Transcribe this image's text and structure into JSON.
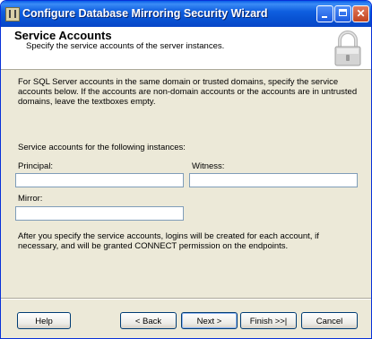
{
  "window": {
    "title": "Configure Database Mirroring Security Wizard"
  },
  "header": {
    "title": "Service Accounts",
    "subtitle": "Specify the service accounts of the server instances."
  },
  "content": {
    "intro": "For SQL Server accounts in the same domain or trusted domains, specify the service accounts below. If the accounts are non-domain accounts or the accounts are in untrusted domains, leave the textboxes empty.",
    "instances_label": "Service accounts for the following instances:",
    "principal": {
      "label": "Principal:",
      "value": ""
    },
    "witness": {
      "label": "Witness:",
      "value": ""
    },
    "mirror": {
      "label": "Mirror:",
      "value": ""
    },
    "note": "After you specify the service accounts, logins will be created for each account, if necessary, and will be granted CONNECT permission on the endpoints."
  },
  "buttons": {
    "help": "Help",
    "back": "< Back",
    "next": "Next >",
    "finish": "Finish >>|",
    "cancel": "Cancel"
  }
}
